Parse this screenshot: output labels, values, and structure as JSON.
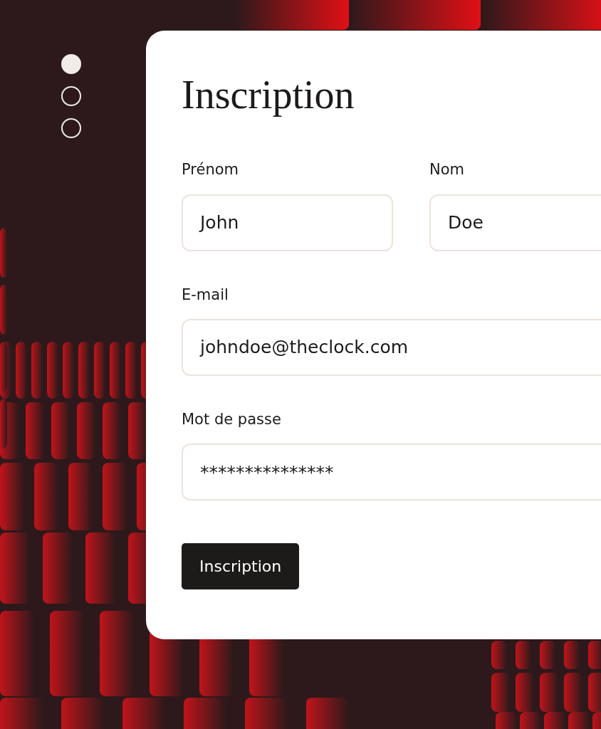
{
  "steps": [
    {
      "selected": true
    },
    {
      "selected": false
    },
    {
      "selected": false
    }
  ],
  "form": {
    "title": "Inscription",
    "fields": [
      {
        "label": "Prénom",
        "value": "John"
      },
      {
        "label": "Nom",
        "value": "Doe"
      },
      {
        "label": "E-mail",
        "value": "johndoe@theclock.com"
      },
      {
        "label": "Mot de passe",
        "value": "***************"
      }
    ],
    "submit": "Inscription"
  }
}
